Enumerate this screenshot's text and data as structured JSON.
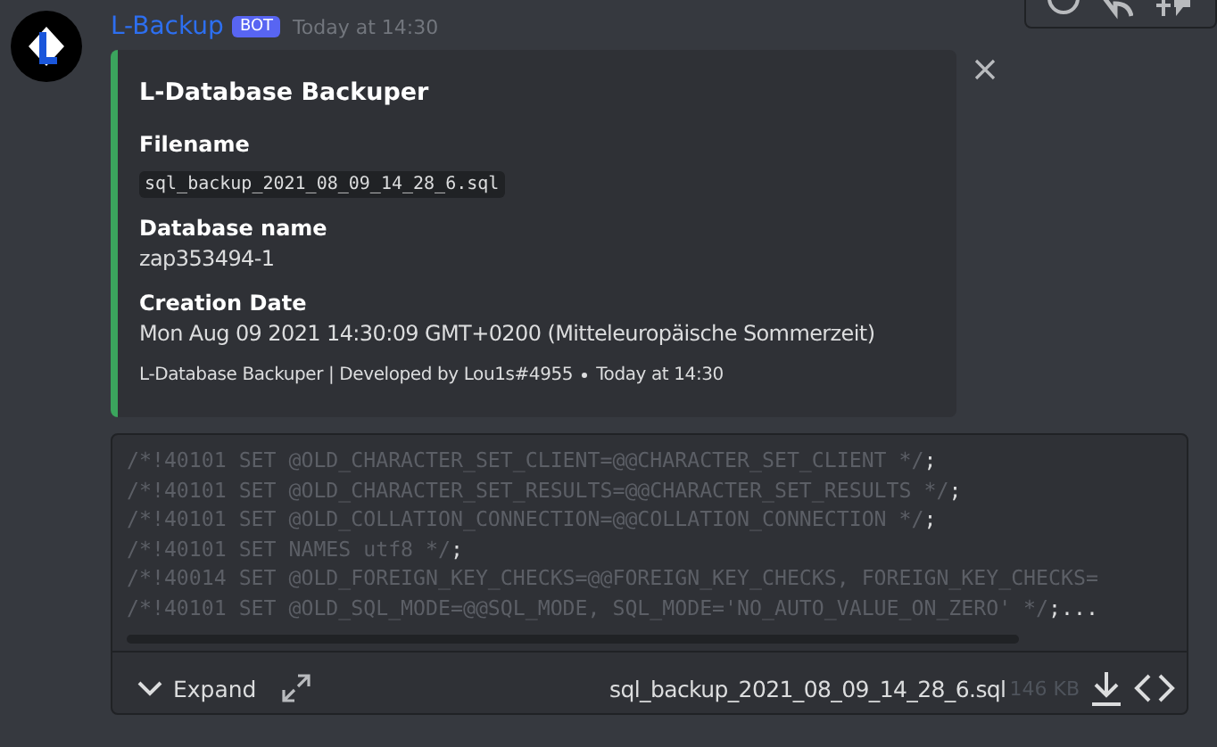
{
  "message": {
    "author": "L-Backup",
    "badge": "BOT",
    "timestamp": "Today at 14:30"
  },
  "embed": {
    "title": "L-Database Backuper",
    "fields": [
      {
        "name": "Filename",
        "value": "sql_backup_2021_08_09_14_28_6.sql",
        "kind": "code"
      },
      {
        "name": "Database name",
        "value": "zap353494-1",
        "kind": "text"
      },
      {
        "name": "Creation Date",
        "value": "Mon Aug 09 2021 14:30:09 GMT+0200 (Mitteleuropäische Sommerzeit)",
        "kind": "text"
      }
    ],
    "footer": "L-Database Backuper | Developed by Lou1s#4955",
    "footer_time": "Today at 14:30"
  },
  "attachment": {
    "lines": [
      {
        "code": "/*!40101 SET @OLD_CHARACTER_SET_CLIENT=@@CHARACTER_SET_CLIENT */",
        "tail": ";"
      },
      {
        "code": "/*!40101 SET @OLD_CHARACTER_SET_RESULTS=@@CHARACTER_SET_RESULTS */",
        "tail": ";"
      },
      {
        "code": "/*!40101 SET @OLD_COLLATION_CONNECTION=@@COLLATION_CONNECTION */",
        "tail": ";"
      },
      {
        "code": "/*!40101 SET NAMES utf8 */",
        "tail": ";"
      },
      {
        "code": "/*!40014 SET @OLD_FOREIGN_KEY_CHECKS=@@FOREIGN_KEY_CHECKS, FOREIGN_KEY_CHECKS="
      },
      {
        "code": "/*!40101 SET @OLD_SQL_MODE=@@SQL_MODE, SQL_MODE='NO_AUTO_VALUE_ON_ZERO' */",
        "tail": ";..."
      }
    ],
    "expand": "Expand",
    "filename": "sql_backup_2021_08_09_14_28_6.sql",
    "size": "146 KB"
  }
}
